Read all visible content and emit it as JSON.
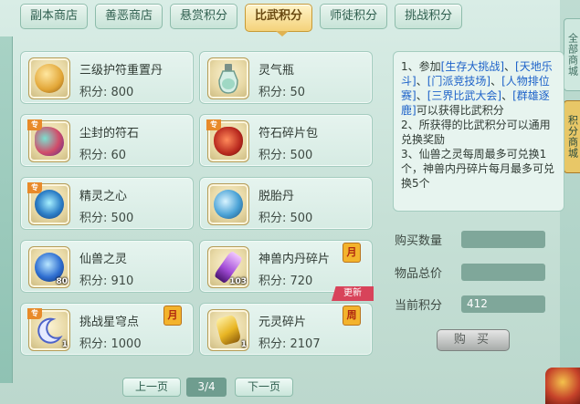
{
  "tabs": [
    {
      "label": "副本商店",
      "active": false
    },
    {
      "label": "善恶商店",
      "active": false
    },
    {
      "label": "悬赏积分",
      "active": false
    },
    {
      "label": "比武积分",
      "active": true
    },
    {
      "label": "师徒积分",
      "active": false
    },
    {
      "label": "挑战积分",
      "active": false
    }
  ],
  "items": [
    {
      "name": "三级护符重置丹",
      "price": "积分: 800",
      "color": "#e2a637"
    },
    {
      "name": "灵气瓶",
      "price": "积分: 50",
      "color": "#b9ddd0"
    },
    {
      "name": "尘封的符石",
      "price": "积分: 60",
      "special": "专",
      "color": "#d14d6a"
    },
    {
      "name": "符石碎片包",
      "price": "积分: 500",
      "special": "专",
      "color": "#b8281e"
    },
    {
      "name": "精灵之心",
      "price": "积分: 500",
      "special": "专",
      "color": "#2d7fc7"
    },
    {
      "name": "脱胎丹",
      "price": "积分: 500",
      "color": "#4aa2d6"
    },
    {
      "name": "仙兽之灵",
      "price": "积分: 910",
      "count": "80",
      "color": "#2f6fd1"
    },
    {
      "name": "神兽内丹碎片",
      "price": "积分: 720",
      "count": "103",
      "limit": "月",
      "update": "更新",
      "color": "#a14bd6"
    },
    {
      "name": "挑战星穹点",
      "price": "积分: 1000",
      "count": "1",
      "special": "专",
      "limit": "月",
      "color": "#4d63c9"
    },
    {
      "name": "元灵碎片",
      "price": "积分: 2107",
      "count": "1",
      "limit": "周",
      "color": "#e8b523"
    }
  ],
  "info": {
    "line1a": "1、参加",
    "link1": "[生存大挑战]",
    "sep1": "、",
    "link2": "[天地乐斗]",
    "sep2": "、",
    "link3": "[门派竞技场]",
    "sep3": "、",
    "link4": "[人物排位赛]",
    "sep4": "、",
    "link5": "[三界比武大会]",
    "sep5": "、",
    "link6": "[群雄逐鹿]",
    "line1b": "可以获得比武积分",
    "line2": "2、所获得的比武积分可以通用兑换奖励",
    "line3": "3、仙兽之灵每周最多可兑换1个，神兽内丹碎片每月最多可兑换5个"
  },
  "form": {
    "qty_label": "购买数量",
    "qty_value": "",
    "total_label": "物品总价",
    "total_value": "",
    "points_label": "当前积分",
    "points_value": "412",
    "buy_label": "购 买"
  },
  "pager": {
    "prev": "上一页",
    "indicator": "3/4",
    "next": "下一页"
  },
  "side_tabs": {
    "top": "全部商城",
    "bottom": "积分商城"
  }
}
